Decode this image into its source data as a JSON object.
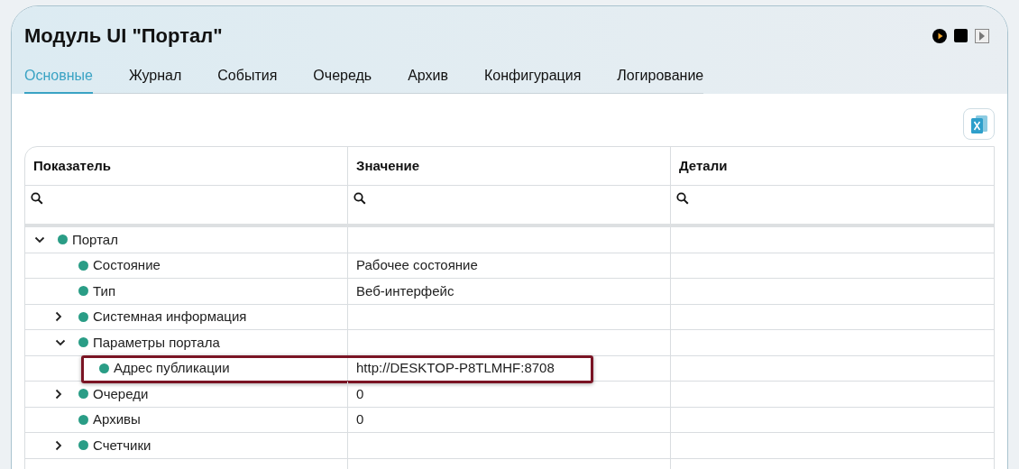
{
  "title": "Модуль UI \"Портал\"",
  "tabs": [
    {
      "label": "Основные",
      "selected": true
    },
    {
      "label": "Журнал",
      "selected": false
    },
    {
      "label": "События",
      "selected": false
    },
    {
      "label": "Очередь",
      "selected": false
    },
    {
      "label": "Архив",
      "selected": false
    },
    {
      "label": "Конфигурация",
      "selected": false
    },
    {
      "label": "Логирование",
      "selected": false
    }
  ],
  "table": {
    "columns": [
      "Показатель",
      "Значение",
      "Детали"
    ],
    "rows": [
      {
        "name": "Портал",
        "color": "#2a9d86",
        "highlighted": false,
        "expanded": true,
        "children": [
          {
            "name": "Состояние",
            "value": "Рабочее состояние",
            "color": "#2a9d86",
            "highlighted": false
          },
          {
            "name": "Тип",
            "value": "Веб-интерфейс",
            "color": "#2a9d86",
            "highlighted": false
          },
          {
            "name": "Системная информация",
            "color": "#2a9d86",
            "highlighted": false,
            "expanded": false
          },
          {
            "name": "Параметры портала",
            "color": "#2a9d86",
            "highlighted": false,
            "expanded": true,
            "children": [
              {
                "name": "Адрес публикации",
                "value": "http://DESKTOP-P8TLMHF:8708",
                "color": "#2a9d86",
                "highlighted": true
              }
            ]
          },
          {
            "name": "Очереди",
            "value": "0",
            "color": "#2a9d86",
            "highlighted": false,
            "expanded": false
          },
          {
            "name": "Архивы",
            "value": "0",
            "color": "#2a9d86",
            "highlighted": false
          },
          {
            "name": "Счетчики",
            "color": "#2a9d86",
            "highlighted": false,
            "expanded": false
          }
        ]
      }
    ]
  }
}
